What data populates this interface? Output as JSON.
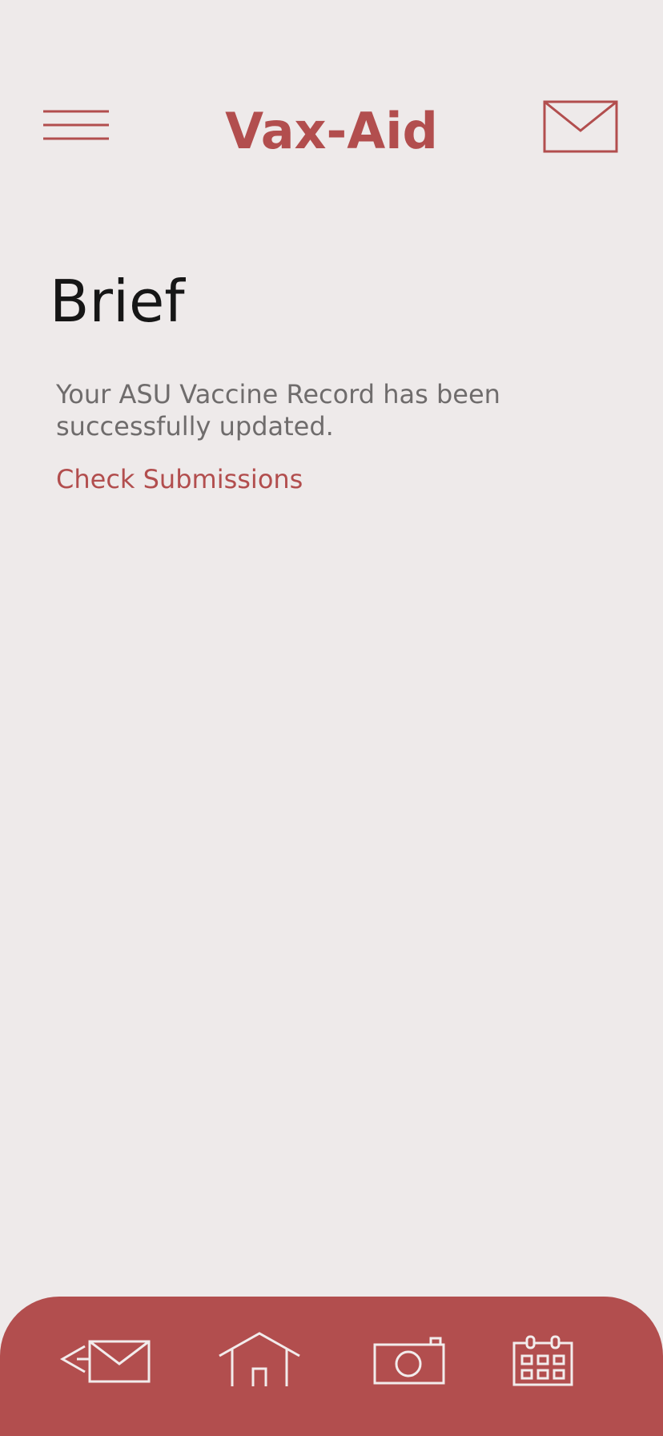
{
  "header": {
    "app_title": "Vax-Aid",
    "menu_icon": "hamburger-menu-icon",
    "mail_icon": "envelope-icon"
  },
  "main": {
    "page_title": "Brief",
    "message": "Your ASU Vaccine Record has been successfully updated.",
    "link_label": "Check Submissions"
  },
  "bottom_nav": {
    "items": [
      {
        "icon": "send-mail-icon"
      },
      {
        "icon": "home-icon"
      },
      {
        "icon": "camera-icon"
      },
      {
        "icon": "calendar-icon"
      }
    ]
  },
  "colors": {
    "background": "#EEEAEA",
    "accent": "#B24E4E",
    "title_text": "#161616",
    "body_text": "#6F6C6C",
    "nav_icon": "#F2ECEC"
  }
}
